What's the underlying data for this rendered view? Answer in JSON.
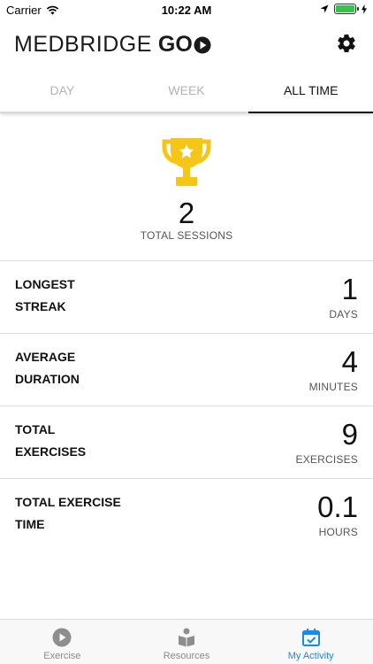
{
  "status_bar": {
    "carrier": "Carrier",
    "time": "10:22 AM"
  },
  "header": {
    "logo_text": "MEDBRIDGE",
    "logo_suffix": "GO"
  },
  "tabs": [
    {
      "label": "DAY",
      "active": false
    },
    {
      "label": "WEEK",
      "active": false
    },
    {
      "label": "ALL TIME",
      "active": true
    }
  ],
  "summary": {
    "icon": "trophy-icon",
    "value": "2",
    "label": "TOTAL SESSIONS"
  },
  "stats": [
    {
      "label_line1": "LONGEST",
      "label_line2": "STREAK",
      "value": "1",
      "unit": "DAYS"
    },
    {
      "label_line1": "AVERAGE",
      "label_line2": "DURATION",
      "value": "4",
      "unit": "MINUTES"
    },
    {
      "label_line1": "TOTAL",
      "label_line2": "EXERCISES",
      "value": "9",
      "unit": "EXERCISES"
    },
    {
      "label_line1": "TOTAL EXERCISE",
      "label_line2": "TIME",
      "value": "0.1",
      "unit": "HOURS"
    }
  ],
  "bottom_nav": [
    {
      "label": "Exercise",
      "icon": "play-circle-icon",
      "active": false
    },
    {
      "label": "Resources",
      "icon": "book-reader-icon",
      "active": false
    },
    {
      "label": "My Activity",
      "icon": "calendar-check-icon",
      "active": true
    }
  ],
  "colors": {
    "accent": "#1e88e5",
    "trophy": "#f5c518",
    "battery": "#36c24f"
  }
}
